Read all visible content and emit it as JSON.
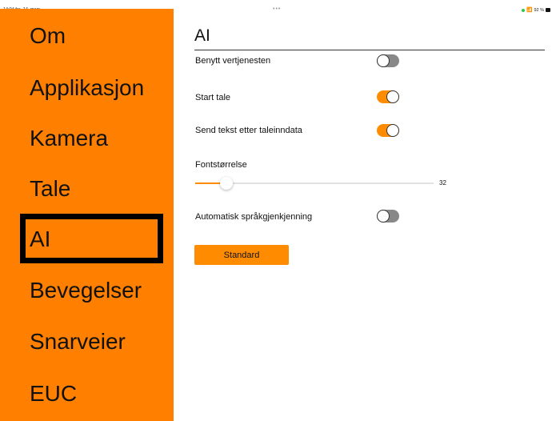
{
  "status_bar": {
    "time_date": "14:04  fre. 14. mars",
    "dots": "•••",
    "battery": "92 %"
  },
  "sidebar": {
    "items": [
      {
        "label": "Om"
      },
      {
        "label": "Applikasjon"
      },
      {
        "label": "Kamera"
      },
      {
        "label": "Tale"
      },
      {
        "label": "AI"
      },
      {
        "label": "Bevegelser"
      },
      {
        "label": "Snarveier"
      },
      {
        "label": "EUC"
      }
    ],
    "selected": "AI",
    "background": "#ff7f00"
  },
  "main": {
    "title": "AI",
    "settings": [
      {
        "label": "Benytt vertjenesten",
        "enabled": false
      },
      {
        "label": "Start tale",
        "enabled": true
      },
      {
        "label": "Send tekst etter taleinndata",
        "enabled": true
      }
    ],
    "font_size": {
      "label": "Fontstørrelse",
      "value": "32",
      "level": 0.13
    },
    "auto_language": {
      "label": "Automatisk språkgjenkjenning",
      "enabled": false
    },
    "standard_button": "Standard"
  },
  "colors": {
    "accent": "#ff8c00",
    "toggle_off": "#888888"
  },
  "icons": {
    "wifi": "wifi-icon",
    "battery": "battery-icon",
    "camera_indicator": "camera-indicator-icon"
  }
}
